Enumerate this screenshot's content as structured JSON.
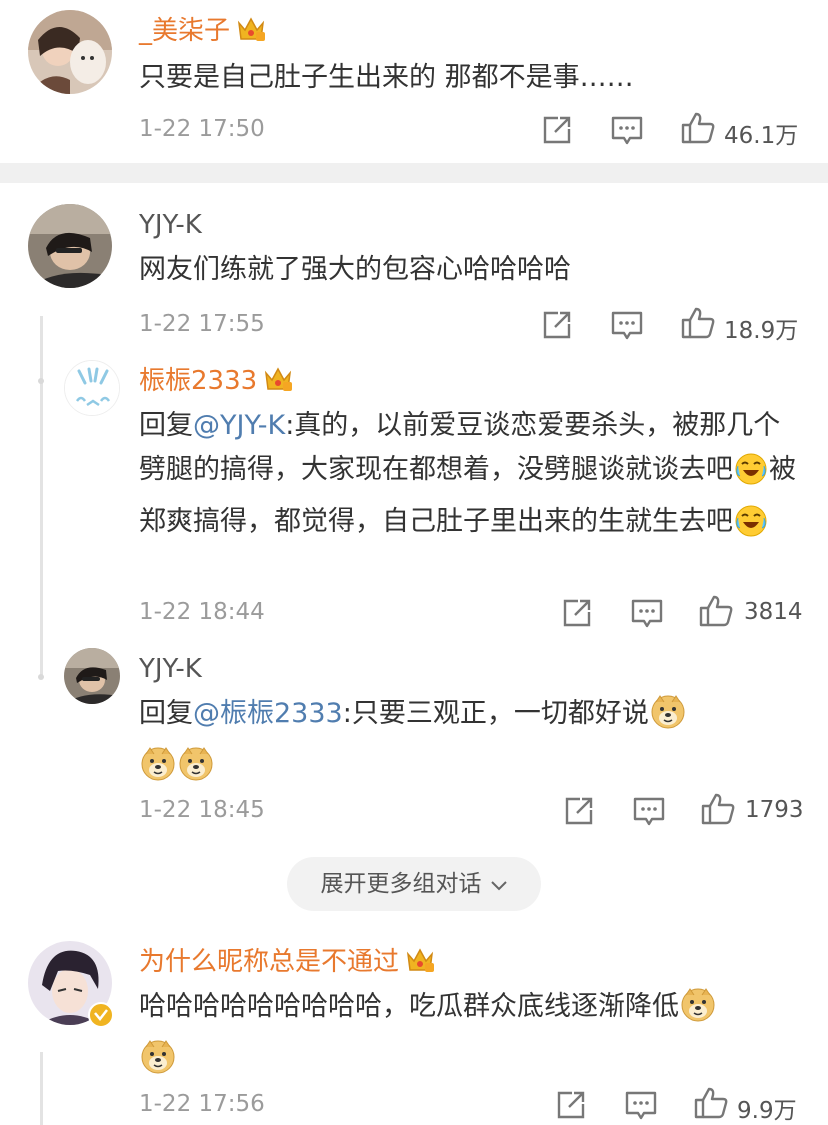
{
  "comments": [
    {
      "username": "_美柒子",
      "text": "只要是自己肚子生出来的 那都不是事……",
      "time": "1-22 17:50",
      "likes": "46.1万"
    },
    {
      "username": "YJY-K",
      "text": "网友们练就了强大的包容心哈哈哈哈",
      "time": "1-22 17:55",
      "likes": "18.9万",
      "replies": [
        {
          "username": "桭桭2333",
          "reply_prefix": "回复",
          "mention": "@YJY-K",
          "text_parts": [
            ":真的，以前爱豆谈恋爱要杀头，被那几个劈腿的搞得，大家现在都想着，没劈腿谈就谈去吧",
            "被郑爽搞得，都觉得，自己肚子里出来的生就生去吧"
          ],
          "time": "1-22 18:44",
          "likes": "3814"
        },
        {
          "username": "YJY-K",
          "reply_prefix": "回复",
          "mention": "@桭桭2333",
          "text": ":只要三观正，一切都好说",
          "time": "1-22 18:45",
          "likes": "1793"
        }
      ]
    },
    {
      "username": "为什么昵称总是不通过",
      "text": "哈哈哈哈哈哈哈哈哈，吃瓜群众底线逐渐降低",
      "time": "1-22 17:56",
      "likes": "9.9万"
    }
  ],
  "expand_label": "展开更多组对话",
  "icons": {
    "share": "share-icon",
    "comment": "comment-icon",
    "like": "thumbs-up-icon",
    "crown": "crown-icon",
    "verified": "verified-badge-icon",
    "emoji_laugh": "laugh-cry-emoji",
    "emoji_doge": "doge-emoji"
  },
  "colors": {
    "username_vip": "#e8792e",
    "username_plain": "#555555",
    "mention": "#507daf",
    "meta": "#9b9b9b",
    "separator": "#f0f0f0"
  }
}
